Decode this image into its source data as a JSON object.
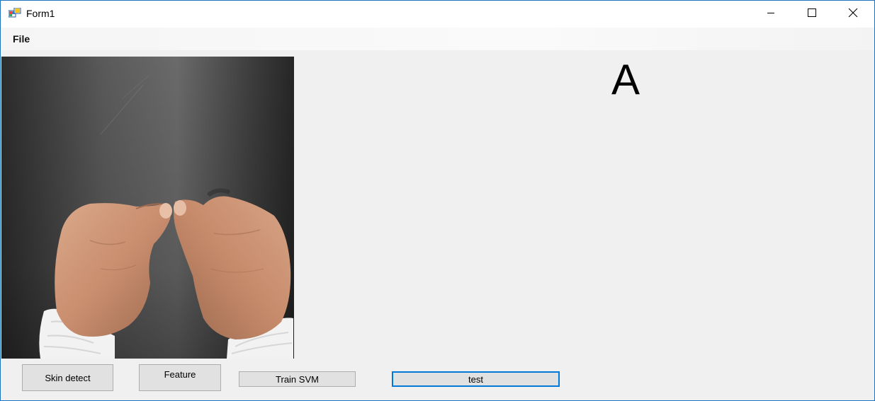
{
  "window": {
    "title": "Form1",
    "border_color": "#1e73be"
  },
  "titlebar": {
    "app_icon": "winforms-app-icon",
    "minimize_icon": "minimize-icon",
    "maximize_icon": "maximize-icon",
    "close_icon": "close-icon"
  },
  "menu": {
    "items": [
      {
        "label": "File"
      }
    ]
  },
  "picture": {
    "content": "hand-gesture-photo"
  },
  "result": {
    "letter": "A"
  },
  "buttons": {
    "skin_detect": "Skin detect",
    "feature": "Feature",
    "train_svm": "Train SVM",
    "test": "test"
  },
  "colors": {
    "form_background": "#f0f0f0",
    "button_face": "#e1e1e1",
    "focus_border": "#0078d7"
  }
}
